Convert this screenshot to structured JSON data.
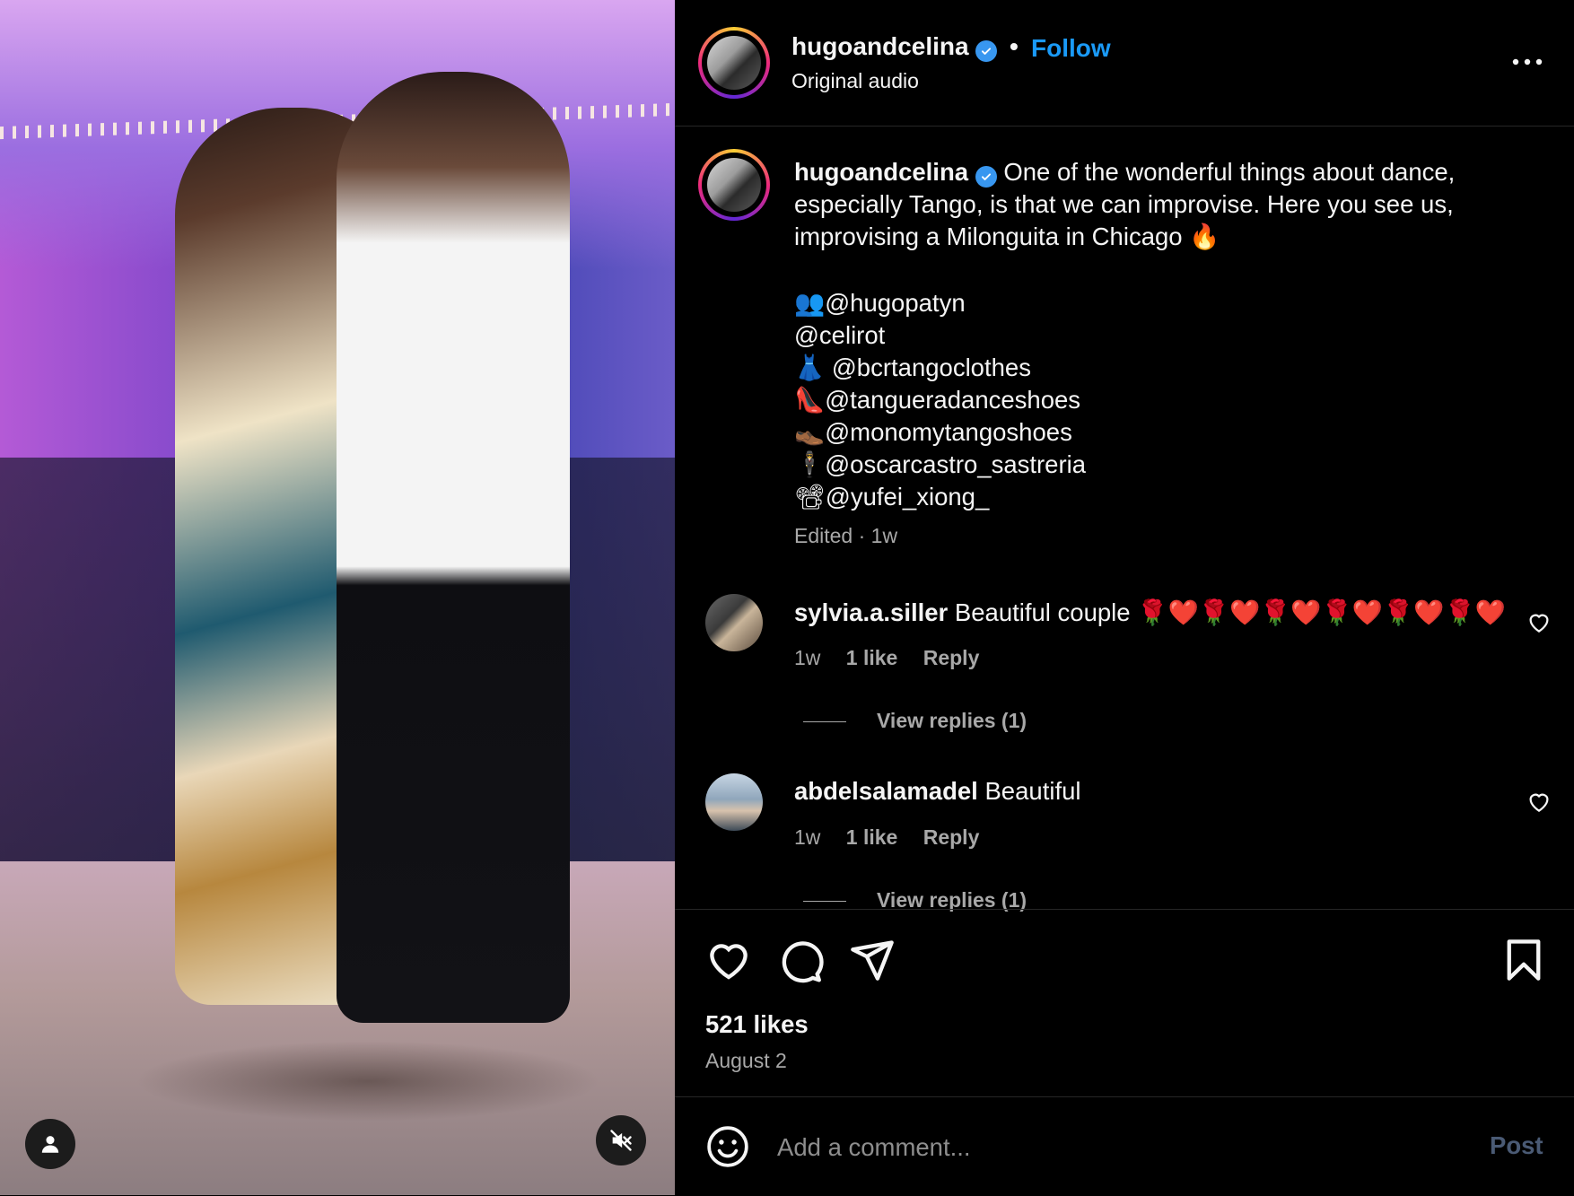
{
  "header": {
    "username": "hugoandcelina",
    "separator": "•",
    "follow_label": "Follow",
    "audio_label": "Original audio"
  },
  "caption": {
    "username": "hugoandcelina",
    "text": "One of the wonderful things about dance, especially Tango, is that we can improvise. Here you see us, improvising a Milonguita in Chicago 🔥",
    "tags": [
      {
        "icon": "👥",
        "handle": "@hugopatyn"
      },
      {
        "icon": "",
        "handle": "@celirot"
      },
      {
        "icon": "👗",
        "handle": " @bcrtangoclothes"
      },
      {
        "icon": "👠",
        "handle": "@tangueradanceshoes"
      },
      {
        "icon": "👞",
        "handle": "@monomytangoshoes"
      },
      {
        "icon": "🕴",
        "handle": "@oscarcastro_sastreria"
      },
      {
        "icon": "📽",
        "handle": "@yufei_xiong_"
      }
    ],
    "edited": "Edited · 1w"
  },
  "comments": [
    {
      "username": "sylvia.a.siller",
      "text": "Beautiful couple 🌹❤️🌹❤️🌹❤️🌹❤️🌹❤️🌹❤️",
      "time": "1w",
      "likes": "1 like",
      "reply_label": "Reply",
      "view_replies": "View replies (1)"
    },
    {
      "username": "abdelsalamadel",
      "text": "Beautiful",
      "time": "1w",
      "likes": "1 like",
      "reply_label": "Reply",
      "view_replies": "View replies (1)"
    }
  ],
  "stats": {
    "likes": "521 likes",
    "date": "August 2"
  },
  "composer": {
    "placeholder": "Add a comment...",
    "post_label": "Post"
  },
  "icons": {
    "like": "heart-icon",
    "comment": "comment-bubble-icon",
    "share": "paper-plane-icon",
    "save": "bookmark-icon",
    "more": "more-horizontal-icon",
    "mute": "speaker-muted-icon",
    "tags": "person-icon",
    "emoji": "smiley-icon"
  },
  "colors": {
    "follow": "#1a9af7",
    "verified": "#3897f0",
    "post_disabled": "#4a5a74"
  }
}
